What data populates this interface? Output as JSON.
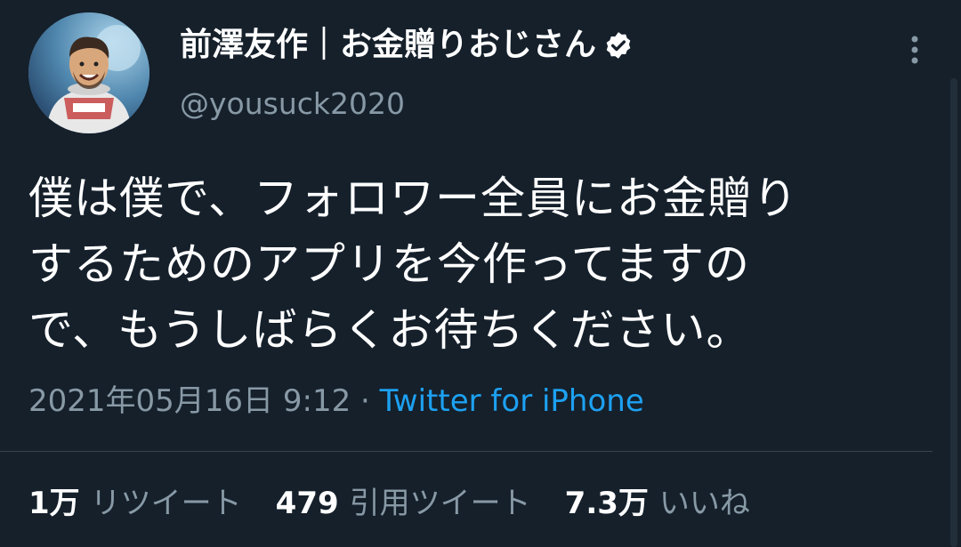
{
  "author": {
    "display_name": "前澤友作｜お金贈りおじさん",
    "handle": "@yousuck2020",
    "verified": true,
    "avatar_icon": "astronaut-avatar"
  },
  "tweet": {
    "text": "僕は僕で、フォロワー全員にお金贈り\nするためのアプリを今作ってますの\nで、もうしばらくお待ちください。",
    "timestamp": "2021年05月16日 9:12",
    "separator": " · ",
    "source": "Twitter for iPhone"
  },
  "stats": {
    "retweets": {
      "count": "1万",
      "label": "リツイート"
    },
    "quotes": {
      "count": "479",
      "label": "引用ツイート"
    },
    "likes": {
      "count": "7.3万",
      "label": "いいね"
    }
  },
  "colors": {
    "background": "#15202b",
    "text": "#ffffff",
    "muted": "#8899a6",
    "link": "#1da1f2",
    "divider": "#38444d"
  }
}
